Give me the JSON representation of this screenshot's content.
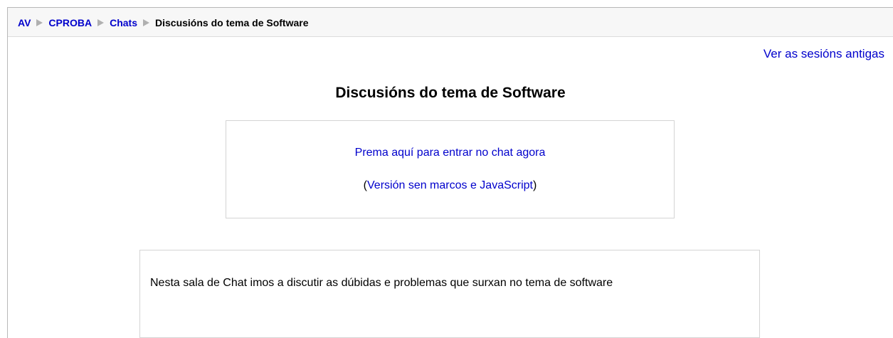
{
  "breadcrumb": {
    "items": [
      {
        "label": "AV",
        "link": true
      },
      {
        "label": "CPROBA",
        "link": true
      },
      {
        "label": "Chats",
        "link": true
      },
      {
        "label": "Discusións do tema de Software",
        "link": false
      }
    ]
  },
  "header": {
    "old_sessions_link": "Ver as sesións antigas"
  },
  "main": {
    "title": "Discusións do tema de Software",
    "enter_chat_link": "Prema aquí para entrar no chat agora",
    "nojs_open_paren": "(",
    "nojs_link": "Versión sen marcos e JavaScript",
    "nojs_close_paren": ")",
    "intro_text": "Nesta sala de Chat imos a discutir as dúbidas e problemas que surxan no tema de software"
  },
  "colors": {
    "link": "#0000cc",
    "border": "#d4d4d4",
    "navbar_bg": "#f7f7f7"
  }
}
